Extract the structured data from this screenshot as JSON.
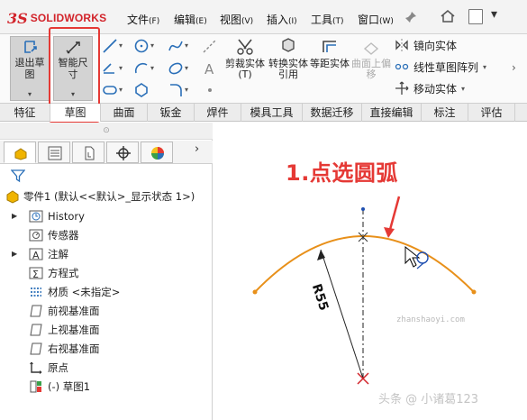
{
  "app": {
    "logo_ds": "3S",
    "logo_text": "SOLIDWORKS"
  },
  "menu": {
    "items": [
      {
        "label": "文件",
        "key": "(F)"
      },
      {
        "label": "编辑",
        "key": "(E)"
      },
      {
        "label": "视图",
        "key": "(V)"
      },
      {
        "label": "插入",
        "key": "(I)"
      },
      {
        "label": "工具",
        "key": "(T)"
      },
      {
        "label": "窗口",
        "key": "(W)"
      }
    ]
  },
  "ribbon": {
    "exit_sketch": "退出草图",
    "smart_dimension": "智能尺寸",
    "trim_entities": "剪裁实体(T)",
    "convert_entities": "转换实体引用",
    "offset_entities": "等距实体",
    "offset_surface": "曲面上偏移",
    "mirror_entities": "镜向实体",
    "linear_pattern": "线性草图阵列",
    "move_entities": "移动实体"
  },
  "tabs": [
    "特征",
    "草图",
    "曲面",
    "钣金",
    "焊件",
    "模具工具",
    "数据迁移",
    "直接编辑",
    "标注",
    "评估"
  ],
  "tabs_active_index": 1,
  "tree": {
    "root": "零件1  (默认<<默认>_显示状态 1>)",
    "items": [
      {
        "label": "History",
        "expandable": true,
        "icon": "history-icon"
      },
      {
        "label": "传感器",
        "expandable": false,
        "icon": "sensor-icon"
      },
      {
        "label": "注解",
        "expandable": true,
        "icon": "annotation-icon"
      },
      {
        "label": "方程式",
        "expandable": false,
        "icon": "equation-icon"
      },
      {
        "label": "材质 <未指定>",
        "expandable": false,
        "icon": "material-icon"
      },
      {
        "label": "前视基准面",
        "expandable": false,
        "icon": "plane-icon"
      },
      {
        "label": "上视基准面",
        "expandable": false,
        "icon": "plane-icon"
      },
      {
        "label": "右视基准面",
        "expandable": false,
        "icon": "plane-icon"
      },
      {
        "label": "原点",
        "expandable": false,
        "icon": "origin-icon"
      },
      {
        "label": "(-) 草图1",
        "expandable": false,
        "icon": "sketch-icon"
      }
    ]
  },
  "canvas": {
    "annotation": "1.点选圆弧",
    "radius_label": "R55",
    "watermark": "zhanshaoyi.com",
    "watermark2": "头条 @ 小诸葛123"
  },
  "colors": {
    "accent_red": "#e53935",
    "arc_orange": "#e8901a",
    "brand_red": "#d2232a"
  }
}
